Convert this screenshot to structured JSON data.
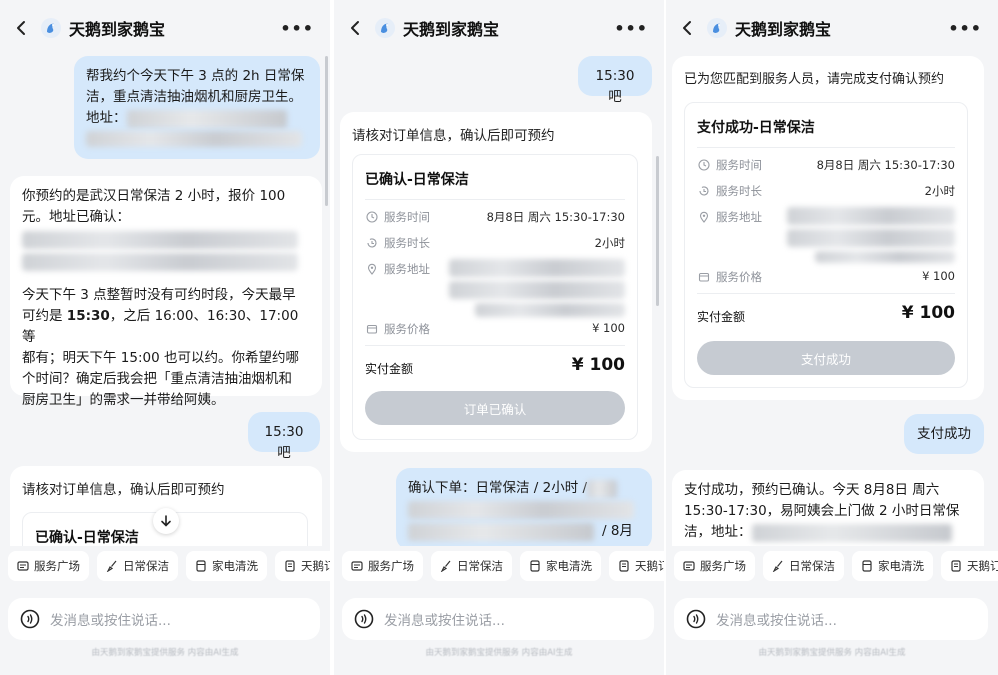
{
  "app": {
    "title": "天鹅到家鹅宝"
  },
  "chips": [
    "服务广场",
    "日常保洁",
    "家电清洗",
    "天鹅订单"
  ],
  "input": {
    "placeholder": "发消息或按住说话..."
  },
  "footer": {
    "note": "由天鹅到家鹅宝提供服务 内容由AI生成"
  },
  "panel1": {
    "user_msg_1": {
      "line1": "帮我约个今天下午 3 点的 2h 日常保",
      "line2": "洁，重点清洁抽油烟机和厨房卫生。",
      "line3": "地址："
    },
    "ai_msg_1": {
      "line1": "你预约的是武汉日常保洁 2 小时，报价 100",
      "line2": "元。地址已确认：",
      "p2_line1": "今天下午 3 点整暂时没有可约时段，今天最早",
      "p2_line2_pre": "可约是 ",
      "p2_line2_bold": "15:30",
      "p2_line2_post": "，之后 16:00、16:30、17:00 等",
      "p2_line3": "都有；明天下午 15:00 也可以约。你希望约哪",
      "p2_line4": "个时间？确定后我会把「重点清洁抽油烟机和",
      "p2_line5": "厨房卫生」的需求一并带给阿姨。"
    },
    "user_msg_2": "15:30吧",
    "ai_msg_2": {
      "intro": "请核对订单信息，确认后即可预约",
      "card_title": "已确认-日常保洁"
    }
  },
  "panel2": {
    "user_msg_1": "15:30吧",
    "ai_msg_1": {
      "intro": "请核对订单信息，确认后即可预约",
      "card_title": "已确认-日常保洁",
      "rows": [
        {
          "label": "服务时间",
          "value": "8月8日 周六 15:30-17:30"
        },
        {
          "label": "服务时长",
          "value": "2小时"
        },
        {
          "label": "服务地址",
          "value": ""
        },
        {
          "label": "服务价格",
          "value": "¥ 100"
        }
      ],
      "pay_label": "实付金额",
      "pay_value": "¥ 100",
      "button": "订单已确认"
    },
    "user_msg_2": {
      "line1_pre": "确认下单：日常保洁 / 2小时 /",
      "line3": "/ 8月"
    }
  },
  "panel3": {
    "ai_msg_1": {
      "intro": "已为您匹配到服务人员，请完成支付确认预约",
      "card_title": "支付成功-日常保洁",
      "rows": [
        {
          "label": "服务时间",
          "value": "8月8日 周六 15:30-17:30"
        },
        {
          "label": "服务时长",
          "value": "2小时"
        },
        {
          "label": "服务地址",
          "value": ""
        },
        {
          "label": "服务价格",
          "value": "¥ 100"
        }
      ],
      "pay_label": "实付金额",
      "pay_value": "¥ 100",
      "button": "支付成功"
    },
    "user_msg_1": "支付成功",
    "ai_msg_2": {
      "line1": "支付成功，预约已确认。今天 8月8日 周六",
      "line2": "15:30-17:30，易阿姨会上门做 2 小时日常保",
      "line3": "洁，地址："
    }
  },
  "colors": {
    "user_bubble": "#d5e8fb",
    "button_disabled": "#c6cbd2",
    "panel_bg": "#f4f5f7"
  }
}
